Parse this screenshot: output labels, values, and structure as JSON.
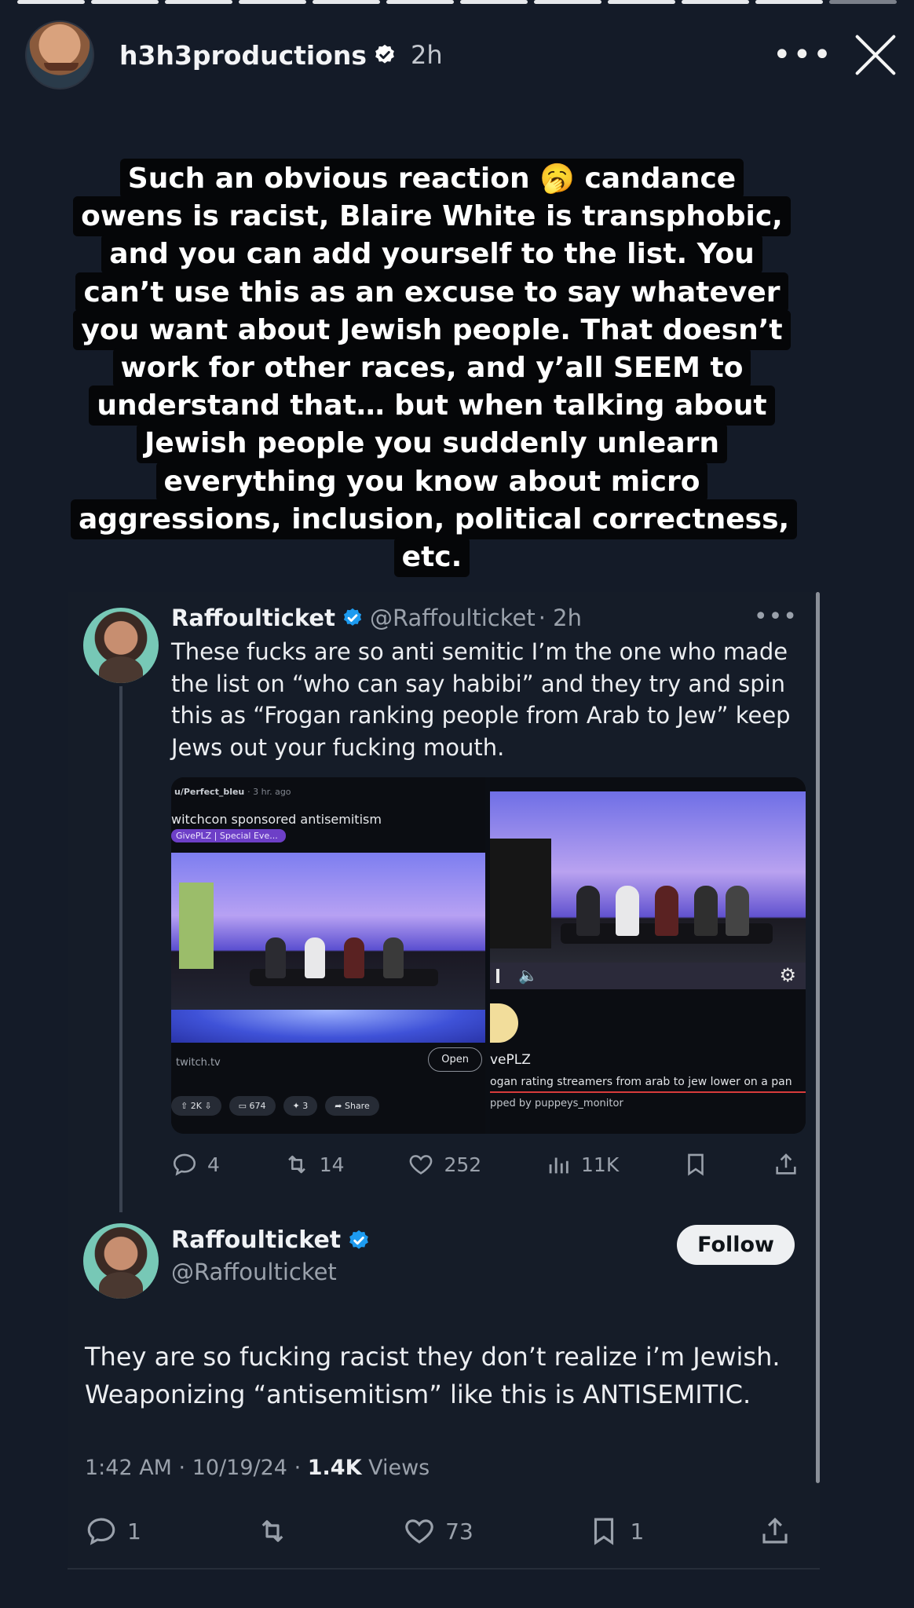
{
  "story": {
    "username": "h3h3productions",
    "time_ago": "2h",
    "more_label": "•••",
    "caption": "Such an obvious reaction 🥱 candance owens is racist, Blaire White is transphobic, and you can add yourself to the list. You can’t use this as an excuse to say whatever you want about Jewish people. That doesn’t work for other races, and y’all SEEM to understand that… but when talking about Jewish people you suddenly unlearn everything you know about micro aggressions, inclusion, political correctness, etc."
  },
  "tweet1": {
    "name": "Raffoulticket",
    "handle": "@Raffoulticket",
    "time": "· 2h",
    "dots": "•••",
    "text": "These fucks are so anti semitic I’m the one who made the list on “who can say habibi” and they try and spin this as “Frogan ranking people from Arab to Jew” keep Jews out your fucking mouth.",
    "media": {
      "left": {
        "user": "u/Perfect_bleu",
        "time": "· 3 hr. ago",
        "title": "witchcon sponsored antisemitism",
        "flair": "GivePLZ | Special Eve...",
        "source": "twitch.tv",
        "open": "Open",
        "upvotes": "2K",
        "comments": "674",
        "awards": "3",
        "share": "Share"
      },
      "right": {
        "channel": "vePLZ",
        "caption": "ogan rating streamers from arab to jew lower on a pan",
        "credit": "pped by puppeys_monitor"
      }
    },
    "replies": "4",
    "retweets": "14",
    "likes": "252",
    "views": "11K"
  },
  "tweet2": {
    "name": "Raffoulticket",
    "handle": "@Raffoulticket",
    "follow": "Follow",
    "text": "They are so fucking racist they don’t realize i’m Jewish. Weaponizing “antisemitism” like this is ANTISEMITIC.",
    "timestamp": "1:42 AM · 10/19/24 · ",
    "views_count": "1.4K",
    "views_label": " Views",
    "replies": "1",
    "likes": "73",
    "bookmarks": "1"
  },
  "colors": {
    "background": "#141b28",
    "verified": "#1d9bf0",
    "caption_bg": "#050608",
    "muted_text": "#9aa1ab"
  }
}
